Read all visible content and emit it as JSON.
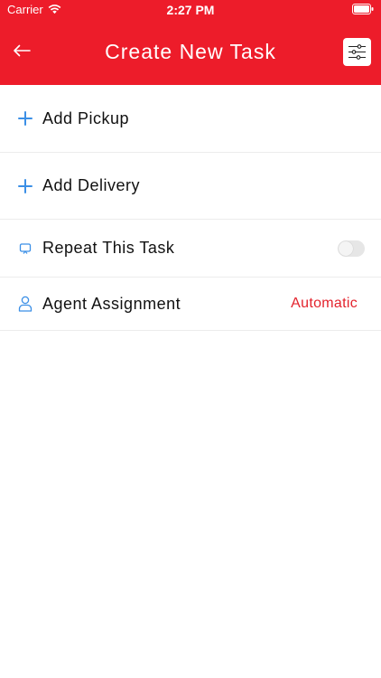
{
  "status_bar": {
    "carrier": "Carrier",
    "time": "2:27 PM",
    "wifi_icon": "wifi-icon",
    "battery_icon": "battery-icon"
  },
  "nav": {
    "title": "Create New Task",
    "back_icon": "arrow-left-icon",
    "filter_icon": "sliders-icon"
  },
  "rows": {
    "pickup": {
      "label": "Add Pickup",
      "icon": "plus-icon"
    },
    "delivery": {
      "label": "Add Delivery",
      "icon": "plus-icon"
    },
    "repeat": {
      "label": "Repeat This Task",
      "icon": "repeat-icon",
      "toggle_on": false
    },
    "agent": {
      "label": "Agent Assignment",
      "value": "Automatic",
      "icon": "user-icon"
    }
  },
  "colors": {
    "brand": "#ed1c2a",
    "accent_blue": "#3b8fe6",
    "value_red": "#e3222c"
  }
}
